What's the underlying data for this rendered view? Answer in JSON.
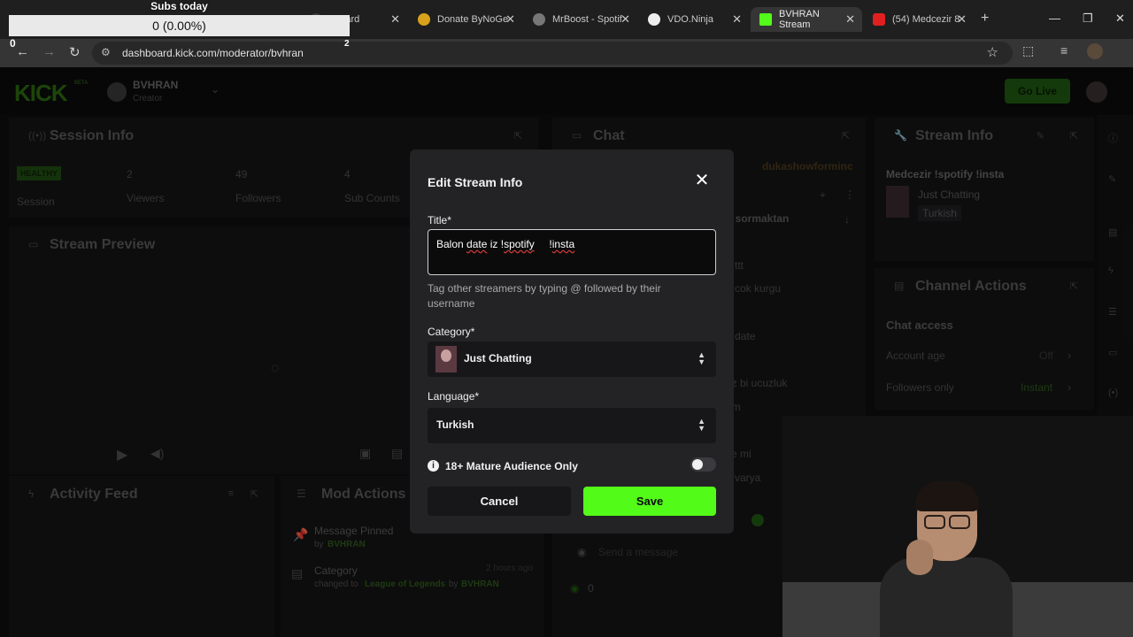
{
  "browser": {
    "tabs": [
      {
        "label": "hboard",
        "icon": "kick-icon"
      },
      {
        "label": "Donate ByNoGe",
        "icon": "donate-icon"
      },
      {
        "label": "MrBoost - Spotif",
        "icon": "globe-icon"
      },
      {
        "label": "VDO.Ninja",
        "icon": "vdo-ninja-icon"
      },
      {
        "label": "BVHRAN Stream",
        "icon": "kick-icon",
        "active": true
      },
      {
        "label": "(54) Medcezir 8",
        "icon": "youtube-icon"
      }
    ],
    "url": "dashboard.kick.com/moderator/bvhran"
  },
  "subs_widget": {
    "title": "Subs today",
    "value_text": "0 (0.00%)",
    "progress": 0.0,
    "min": "0",
    "max": "2"
  },
  "header": {
    "logo": "KICK",
    "logo_badge": "BETA",
    "creator_name": "BVHRAN",
    "creator_role": "Creator",
    "go_live_label": "Go Live"
  },
  "session_info": {
    "title": "Session Info",
    "status_badge": "HEALTHY",
    "status_label": "Session",
    "stats": [
      {
        "value": "2",
        "label": "Viewers"
      },
      {
        "value": "49",
        "label": "Followers"
      },
      {
        "value": "4",
        "label": "Sub Counts"
      }
    ]
  },
  "stream_preview": {
    "title": "Stream Preview"
  },
  "activity_feed": {
    "title": "Activity Feed"
  },
  "mod_actions": {
    "title": "Mod Actions",
    "items": [
      {
        "title": "Message Pinned",
        "prefix": "by",
        "actor": "BVHRAN",
        "time": ""
      },
      {
        "title": "Category",
        "prefix": "changed to",
        "target": "League of Legends",
        "by": "by",
        "actor": "BVHRAN",
        "time": "2 hours ago"
      }
    ]
  },
  "chat": {
    "title": "Chat",
    "top_user": "dukashowforminc",
    "pinned_snippet": "n sormaktan",
    "fragments": [
      "ttt",
      "cok kurgu",
      "n date",
      "uz bi ucuzluk",
      "um",
      "ye mi",
      "a varya"
    ],
    "input_placeholder": "Send a message",
    "count": "0"
  },
  "stream_info": {
    "title": "Stream Info",
    "stream_title": "Medcezir !spotify !insta",
    "category": "Just Chatting",
    "language": "Turkish"
  },
  "channel_actions": {
    "title": "Channel Actions",
    "section": "Chat access",
    "rows": [
      {
        "label": "Account age",
        "value": "Off"
      },
      {
        "label": "Followers only",
        "value": "Instant"
      }
    ]
  },
  "modal": {
    "heading": "Edit Stream Info",
    "title_label": "Title*",
    "title_value_parts": [
      "Balon ",
      "date",
      " iz !",
      "spotify",
      "     !",
      "insta"
    ],
    "helper_text": "Tag other streamers by typing @ followed by their username",
    "category_label": "Category*",
    "category_value": "Just Chatting",
    "language_label": "Language*",
    "language_value": "Turkish",
    "mature_label": "18+ Mature Audience Only",
    "mature_enabled": false,
    "cancel_label": "Cancel",
    "save_label": "Save"
  },
  "colors": {
    "accent": "#53fc18",
    "modal_bg": "#232325",
    "page_bg": "#0f0f10"
  }
}
